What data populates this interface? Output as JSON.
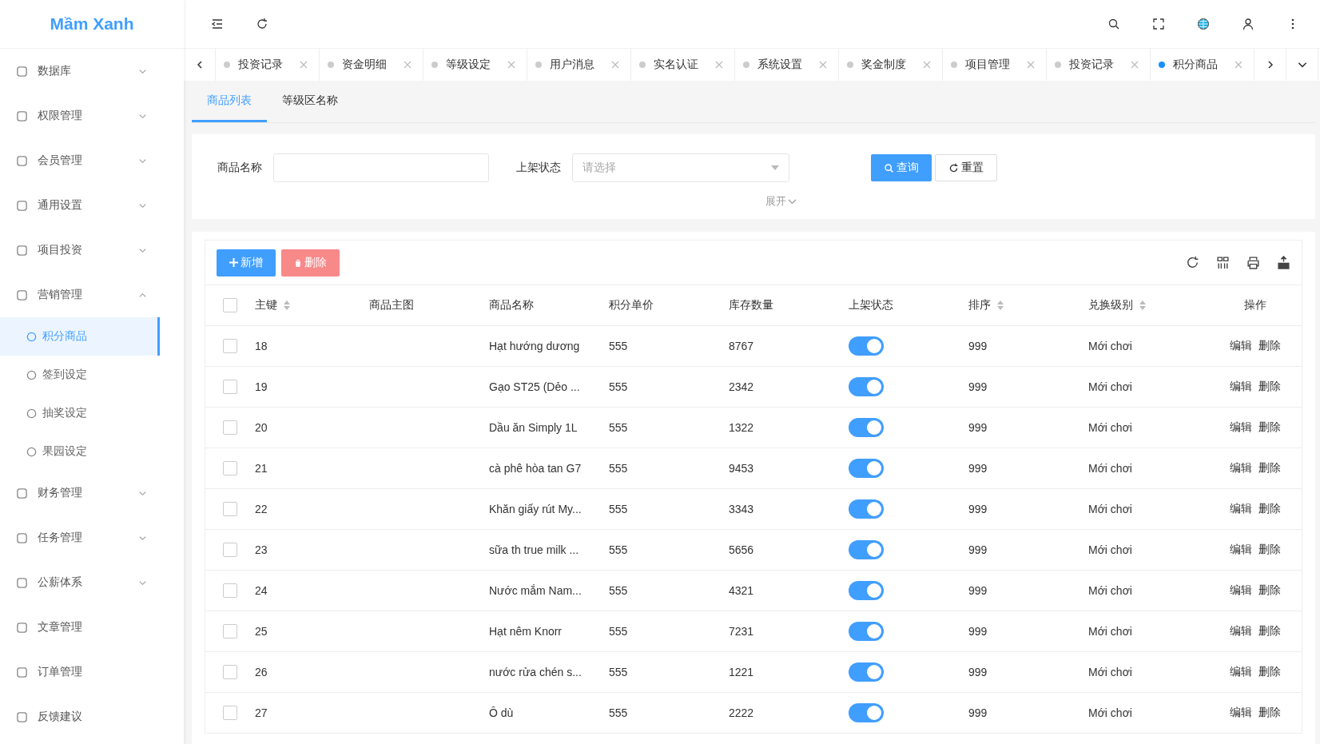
{
  "brand": "Mầm Xanh",
  "sidebar": {
    "items": [
      {
        "label": "数据库",
        "expanded": false
      },
      {
        "label": "权限管理",
        "expanded": false
      },
      {
        "label": "会员管理",
        "expanded": false
      },
      {
        "label": "通用设置",
        "expanded": false
      },
      {
        "label": "项目投资",
        "expanded": false
      },
      {
        "label": "营销管理",
        "expanded": true,
        "children": [
          {
            "label": "积分商品",
            "selected": true
          },
          {
            "label": "签到设定",
            "selected": false
          },
          {
            "label": "抽奖设定",
            "selected": false
          },
          {
            "label": "果园设定",
            "selected": false
          }
        ]
      },
      {
        "label": "财务管理",
        "expanded": false
      },
      {
        "label": "任务管理",
        "expanded": false
      },
      {
        "label": "公薪体系",
        "expanded": false
      },
      {
        "label": "文章管理"
      },
      {
        "label": "订单管理"
      },
      {
        "label": "反馈建议"
      }
    ]
  },
  "tabs": [
    {
      "label": "投资记录",
      "selected": false
    },
    {
      "label": "资金明细",
      "selected": false
    },
    {
      "label": "等级设定",
      "selected": false
    },
    {
      "label": "用户消息",
      "selected": false
    },
    {
      "label": "实名认证",
      "selected": false
    },
    {
      "label": "系统设置",
      "selected": false
    },
    {
      "label": "奖金制度",
      "selected": false
    },
    {
      "label": "项目管理",
      "selected": false
    },
    {
      "label": "投资记录",
      "selected": false
    },
    {
      "label": "积分商品",
      "selected": true
    }
  ],
  "subtabs": [
    {
      "label": "商品列表",
      "selected": true
    },
    {
      "label": "等级区名称",
      "selected": false
    }
  ],
  "filters": {
    "name_label": "商品名称",
    "status_label": "上架状态",
    "status_placeholder": "请选择",
    "query_button": "查询",
    "reset_button": "重置",
    "expand_link": "展开"
  },
  "toolbar": {
    "add_button": "新增",
    "delete_button": "删除"
  },
  "table": {
    "select_all_checked": false,
    "columns": [
      {
        "label": "主键",
        "sortable": true
      },
      {
        "label": "商品主图",
        "sortable": false
      },
      {
        "label": "商品名称",
        "sortable": false
      },
      {
        "label": "积分单价",
        "sortable": false
      },
      {
        "label": "库存数量",
        "sortable": false
      },
      {
        "label": "上架状态",
        "sortable": false
      },
      {
        "label": "排序",
        "sortable": true
      },
      {
        "label": "兑换级别",
        "sortable": true
      },
      {
        "label": "操作",
        "sortable": false
      }
    ],
    "rows": [
      {
        "checked": false,
        "id": "18",
        "name": "Hạt hướng dương",
        "points": "555",
        "stock": "8767",
        "on": true,
        "sort": "999",
        "level": "Mới chơi",
        "edit": "编辑",
        "delete": "删除"
      },
      {
        "checked": false,
        "id": "19",
        "name": "Gạo ST25 (Dẻo ...",
        "points": "555",
        "stock": "2342",
        "on": true,
        "sort": "999",
        "level": "Mới chơi",
        "edit": "编辑",
        "delete": "删除"
      },
      {
        "checked": false,
        "id": "20",
        "name": "Dầu ăn Simply 1L",
        "points": "555",
        "stock": "1322",
        "on": true,
        "sort": "999",
        "level": "Mới chơi",
        "edit": "编辑",
        "delete": "删除"
      },
      {
        "checked": false,
        "id": "21",
        "name": "cà phê hòa tan G7",
        "points": "555",
        "stock": "9453",
        "on": true,
        "sort": "999",
        "level": "Mới chơi",
        "edit": "编辑",
        "delete": "删除"
      },
      {
        "checked": false,
        "id": "22",
        "name": "Khăn giấy rút My...",
        "points": "555",
        "stock": "3343",
        "on": true,
        "sort": "999",
        "level": "Mới chơi",
        "edit": "编辑",
        "delete": "删除"
      },
      {
        "checked": false,
        "id": "23",
        "name": "sữa th true milk ...",
        "points": "555",
        "stock": "5656",
        "on": true,
        "sort": "999",
        "level": "Mới chơi",
        "edit": "编辑",
        "delete": "删除"
      },
      {
        "checked": false,
        "id": "24",
        "name": "Nước mắm Nam...",
        "points": "555",
        "stock": "4321",
        "on": true,
        "sort": "999",
        "level": "Mới chơi",
        "edit": "编辑",
        "delete": "删除"
      },
      {
        "checked": false,
        "id": "25",
        "name": "Hạt nêm Knorr",
        "points": "555",
        "stock": "7231",
        "on": true,
        "sort": "999",
        "level": "Mới chơi",
        "edit": "编辑",
        "delete": "删除"
      },
      {
        "checked": false,
        "id": "26",
        "name": "nước rửa chén s...",
        "points": "555",
        "stock": "1221",
        "on": true,
        "sort": "999",
        "level": "Mới chơi",
        "edit": "编辑",
        "delete": "删除"
      },
      {
        "checked": false,
        "id": "27",
        "name": "Ô dù",
        "points": "555",
        "stock": "2222",
        "on": true,
        "sort": "999",
        "level": "Mới chơi",
        "edit": "编辑",
        "delete": "删除"
      }
    ]
  }
}
